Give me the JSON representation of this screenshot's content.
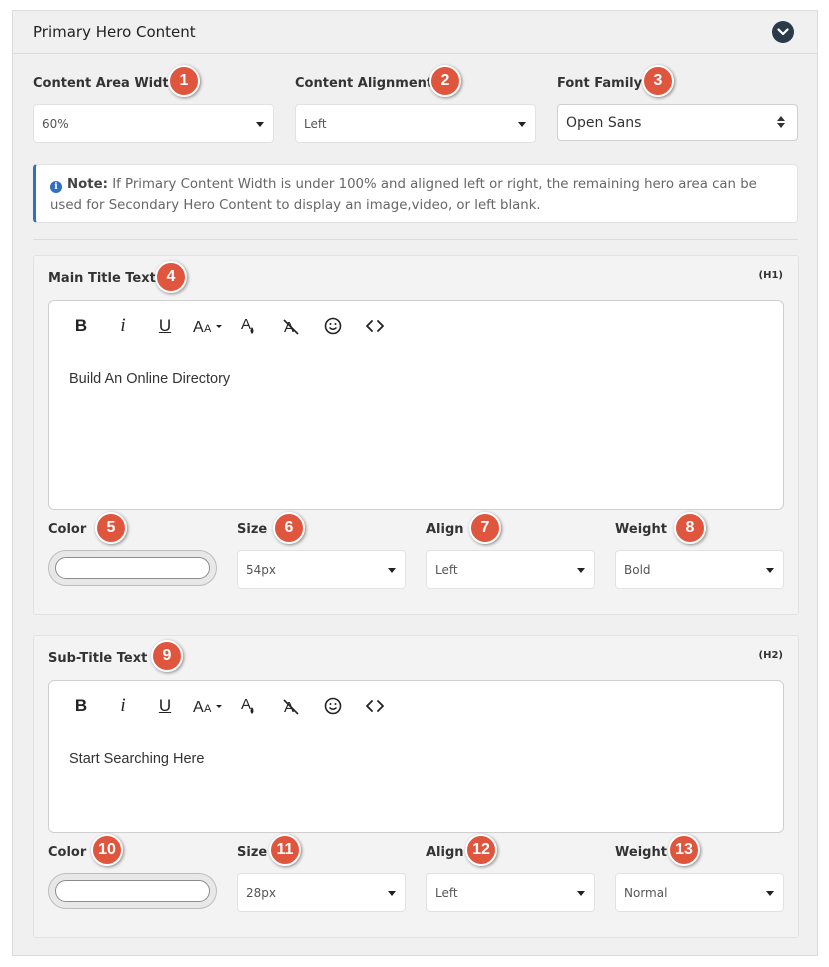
{
  "panel": {
    "title": "Primary Hero Content"
  },
  "layout_settings": {
    "content_area_width": {
      "label": "Content Area Width",
      "badge": "1",
      "value": "60%"
    },
    "content_alignment": {
      "label": "Content Alignment",
      "badge": "2",
      "value": "Left"
    },
    "font_family": {
      "label": "Font Family",
      "badge": "3",
      "value": "Open Sans"
    }
  },
  "note": {
    "label": "Note:",
    "text": "If Primary Content Width is under 100% and aligned left or right, the remaining hero area can be used for Secondary Hero Content to display an image,video, or left blank."
  },
  "main_title": {
    "label": "Main Title Text",
    "badge": "4",
    "tag": "(H1)",
    "content": "Build An Online Directory",
    "color": {
      "label": "Color",
      "badge": "5"
    },
    "size": {
      "label": "Size",
      "badge": "6",
      "value": "54px"
    },
    "align": {
      "label": "Align",
      "badge": "7",
      "value": "Left"
    },
    "weight": {
      "label": "Weight",
      "badge": "8",
      "value": "Bold"
    }
  },
  "sub_title": {
    "label": "Sub-Title Text",
    "badge": "9",
    "tag": "(H2)",
    "content": "Start Searching Here",
    "color": {
      "label": "Color",
      "badge": "10"
    },
    "size": {
      "label": "Size",
      "badge": "11",
      "value": "28px"
    },
    "align": {
      "label": "Align",
      "badge": "12",
      "value": "Left"
    },
    "weight": {
      "label": "Weight",
      "badge": "13",
      "value": "Normal"
    }
  },
  "toolbar": {
    "bold": "B",
    "italic": "i",
    "underline": "U",
    "font_size": "AA",
    "icons": [
      "bold-icon",
      "italic-icon",
      "underline-icon",
      "font-size-icon",
      "text-color-icon",
      "clear-format-icon",
      "emoji-icon",
      "code-view-icon"
    ]
  },
  "colors": {
    "badge": "#e0553d",
    "collapse_button": "#2b3a4a",
    "note_accent": "#2f6fc4"
  }
}
